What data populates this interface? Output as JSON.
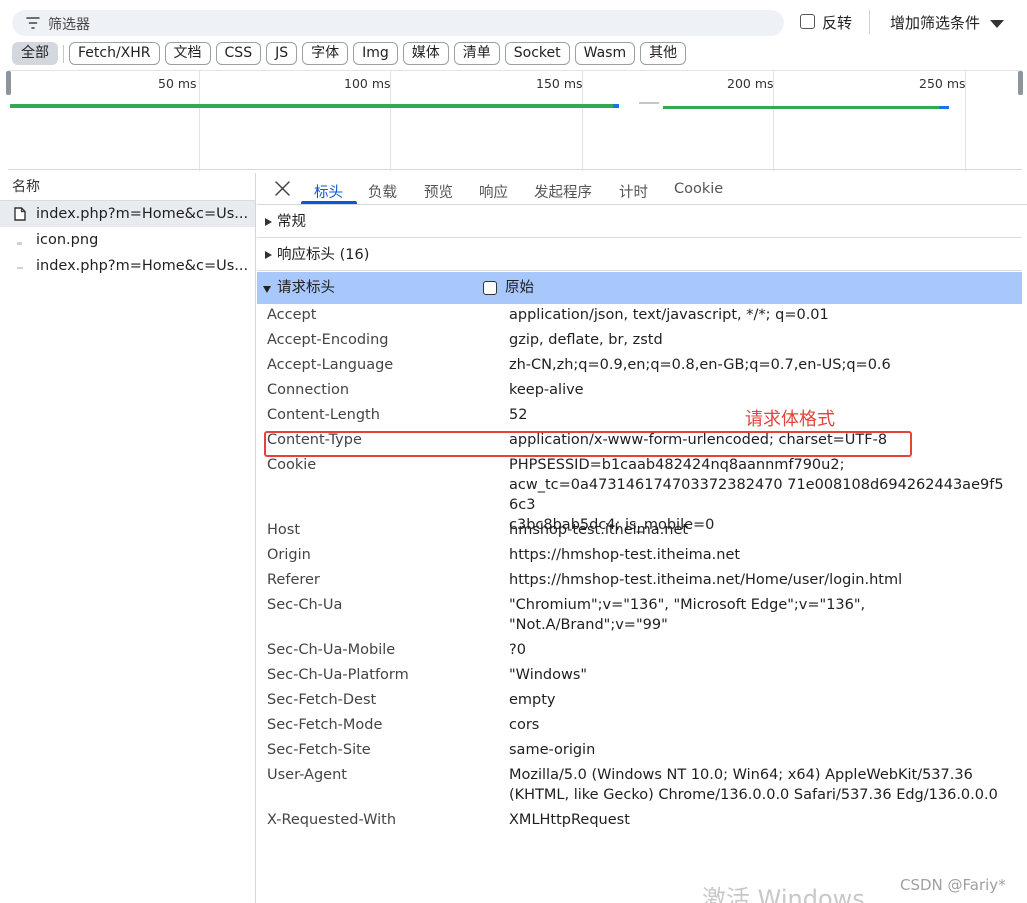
{
  "filter": {
    "placeholder": "筛选器",
    "invert_label": "反转",
    "add_filter_label": "增加筛选条件"
  },
  "type_chips": [
    "全部",
    "Fetch/XHR",
    "文档",
    "CSS",
    "JS",
    "字体",
    "Img",
    "媒体",
    "清单",
    "Socket",
    "Wasm",
    "其他"
  ],
  "timeline": {
    "ticks": [
      "50 ms",
      "100 ms",
      "150 ms",
      "200 ms",
      "250 ms"
    ]
  },
  "request_list": {
    "header": "名称",
    "items": [
      "index.php?m=Home&c=Us...",
      "icon.png",
      "index.php?m=Home&c=Us..."
    ]
  },
  "tabs": [
    "标头",
    "负载",
    "预览",
    "响应",
    "发起程序",
    "计时",
    "Cookie"
  ],
  "sections": {
    "general": "常规",
    "response_headers": "响应标头 (16)",
    "request_headers": "请求标头",
    "raw_label": "原始"
  },
  "request_headers": [
    {
      "k": "Accept",
      "v": "application/json, text/javascript, */*; q=0.01"
    },
    {
      "k": "Accept-Encoding",
      "v": "gzip, deflate, br, zstd"
    },
    {
      "k": "Accept-Language",
      "v": "zh-CN,zh;q=0.9,en;q=0.8,en-GB;q=0.7,en-US;q=0.6"
    },
    {
      "k": "Connection",
      "v": "keep-alive"
    },
    {
      "k": "Content-Length",
      "v": "52"
    },
    {
      "k": "Content-Type",
      "v": "application/x-www-form-urlencoded; charset=UTF-8"
    },
    {
      "k": "Cookie",
      "v": "PHPSESSID=b1caab482424nq8aannmf790u2;\nacw_tc=0a473146174703372382470 71e008108d694262443ae9f56c3\nc3bc8bab5dc4; is_mobile=0"
    },
    {
      "k": "Host",
      "v": "hmshop-test.itheima.net"
    },
    {
      "k": "Origin",
      "v": "https://hmshop-test.itheima.net"
    },
    {
      "k": "Referer",
      "v": "https://hmshop-test.itheima.net/Home/user/login.html"
    },
    {
      "k": "Sec-Ch-Ua",
      "v": "\"Chromium\";v=\"136\", \"Microsoft Edge\";v=\"136\",\n\"Not.A/Brand\";v=\"99\""
    },
    {
      "k": "Sec-Ch-Ua-Mobile",
      "v": "?0"
    },
    {
      "k": "Sec-Ch-Ua-Platform",
      "v": "\"Windows\""
    },
    {
      "k": "Sec-Fetch-Dest",
      "v": "empty"
    },
    {
      "k": "Sec-Fetch-Mode",
      "v": "cors"
    },
    {
      "k": "Sec-Fetch-Site",
      "v": "same-origin"
    },
    {
      "k": "User-Agent",
      "v": "Mozilla/5.0 (Windows NT 10.0; Win64; x64) AppleWebKit/537.36\n(KHTML, like Gecko) Chrome/136.0.0.0 Safari/537.36 Edg/136.0.0.0"
    },
    {
      "k": "X-Requested-With",
      "v": "XMLHttpRequest"
    }
  ],
  "annotation": "请求体格式",
  "watermark": "激活 Windows",
  "credit": "CSDN @Fariy*",
  "colors": {
    "accent": "#0b57d0",
    "annotation_red": "#e2443a",
    "section_open_bg": "#a8c7fa"
  }
}
